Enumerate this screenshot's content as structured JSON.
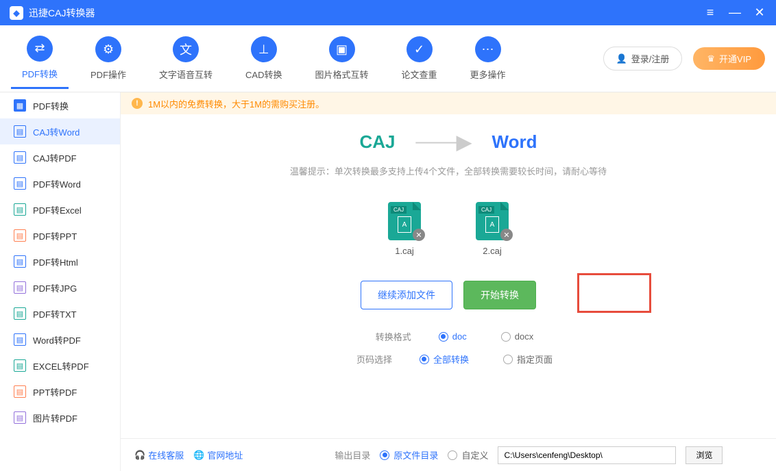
{
  "title": "迅捷CAJ转换器",
  "topnav": [
    {
      "label": "PDF转换"
    },
    {
      "label": "PDF操作"
    },
    {
      "label": "文字语音互转"
    },
    {
      "label": "CAD转换"
    },
    {
      "label": "图片格式互转"
    },
    {
      "label": "论文查重"
    },
    {
      "label": "更多操作"
    }
  ],
  "login": "登录/注册",
  "vip": "开通VIP",
  "sidebar": {
    "header": "PDF转换",
    "items": [
      {
        "label": "CAJ转Word",
        "active": true,
        "color": "#2e73fb"
      },
      {
        "label": "CAJ转PDF",
        "color": "#2e73fb"
      },
      {
        "label": "PDF转Word",
        "color": "#2e73fb"
      },
      {
        "label": "PDF转Excel",
        "color": "#1aa896"
      },
      {
        "label": "PDF转PPT",
        "color": "#ff7f50"
      },
      {
        "label": "PDF转Html",
        "color": "#2e73fb"
      },
      {
        "label": "PDF转JPG",
        "color": "#9370db"
      },
      {
        "label": "PDF转TXT",
        "color": "#1aa896"
      },
      {
        "label": "Word转PDF",
        "color": "#2e73fb"
      },
      {
        "label": "EXCEL转PDF",
        "color": "#1aa896"
      },
      {
        "label": "PPT转PDF",
        "color": "#ff7f50"
      },
      {
        "label": "图片转PDF",
        "color": "#9370db"
      }
    ]
  },
  "notice": "1M以内的免费转换，大于1M的需购买注册。",
  "conv": {
    "from": "CAJ",
    "to": "Word"
  },
  "tip": "温馨提示：单次转换最多支持上传4个文件，全部转换需要较长时间，请耐心等待",
  "files": [
    {
      "name": "1.caj"
    },
    {
      "name": "2.caj"
    }
  ],
  "buttons": {
    "add": "继续添加文件",
    "start": "开始转换"
  },
  "format": {
    "label": "转换格式",
    "opts": [
      "doc",
      "docx"
    ],
    "selected": "doc"
  },
  "pages": {
    "label": "页码选择",
    "opts": [
      "全部转换",
      "指定页面"
    ],
    "selected": "全部转换"
  },
  "footer": {
    "service": "在线客服",
    "site": "官网地址",
    "outlabel": "输出目录",
    "orig": "原文件目录",
    "custom": "自定义",
    "path": "C:\\Users\\cenfeng\\Desktop\\",
    "browse": "浏览"
  }
}
